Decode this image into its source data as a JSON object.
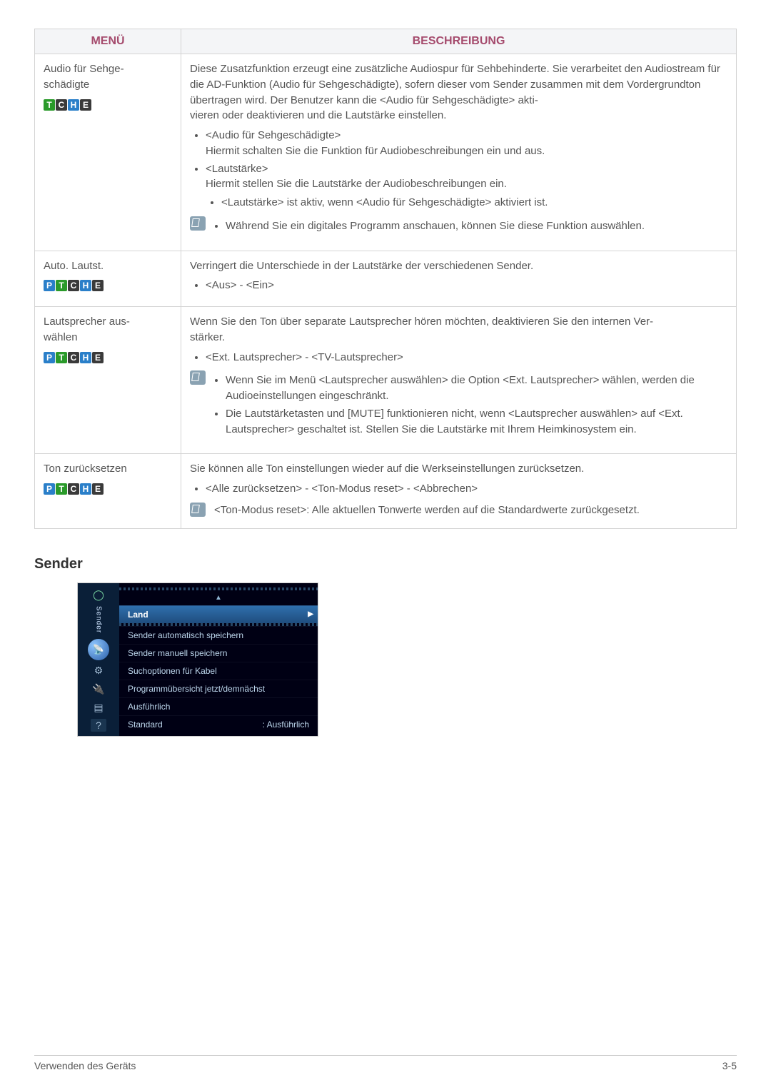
{
  "table": {
    "headers": {
      "menu": "MENÜ",
      "desc": "BESCHREIBUNG"
    },
    "rows": [
      {
        "left": {
          "title": "Audio für Sehge-\nschädigte",
          "badges": [
            "T",
            "C",
            "H",
            "E"
          ]
        },
        "para": "Diese Zusatzfunktion erzeugt eine zusätzliche Audiospur für Sehbehinderte. Sie verarbeitet den Audiostream für die AD-Funktion (Audio für Sehgeschädigte), sofern dieser vom Sender zusammen mit dem Vordergrundton übertragen wird. Der Benutzer kann die <Audio für Sehgeschädigte> akti-\nvieren oder deaktivieren und die Lautstärke einstellen.",
        "bullets": [
          {
            "head": "<Audio für Sehgeschädigte>",
            "body": "Hiermit schalten Sie die Funktion für Audiobeschreibungen ein und aus."
          },
          {
            "head": "<Lautstärke>",
            "body": "Hiermit stellen Sie die Lautstärke der Audiobeschreibungen ein.",
            "sub": [
              "<Lautstärke> ist aktiv, wenn <Audio für Sehgeschädigte> aktiviert ist."
            ]
          }
        ],
        "note_bullets": [
          "Während Sie ein digitales Programm anschauen, können Sie diese Funktion auswählen."
        ]
      },
      {
        "left": {
          "title": "Auto. Lautst.",
          "badges": [
            "P",
            "T",
            "C",
            "H",
            "E"
          ]
        },
        "para": "Verringert die Unterschiede in der Lautstärke der verschiedenen Sender.",
        "bullets": [
          {
            "head": "<Aus> - <Ein>"
          }
        ]
      },
      {
        "left": {
          "title": "Lautsprecher aus-\nwählen",
          "badges": [
            "P",
            "T",
            "C",
            "H",
            "E"
          ]
        },
        "para": "Wenn Sie den Ton über separate Lautsprecher hören möchten, deaktivieren Sie den internen Ver-\nstärker.",
        "bullets": [
          {
            "head": "<Ext. Lautsprecher> - <TV-Lautsprecher>"
          }
        ],
        "note_bullets": [
          "Wenn Sie im Menü <Lautsprecher auswählen> die Option <Ext. Lautsprecher> wählen, werden die Audioeinstellungen eingeschränkt.",
          "Die Lautstärketasten und [MUTE] funktionieren nicht, wenn <Lautsprecher auswählen> auf <Ext. Lautsprecher> geschaltet ist. Stellen Sie die Lautstärke mit Ihrem Heimkinosystem ein."
        ]
      },
      {
        "left": {
          "title": "Ton zurücksetzen",
          "badges": [
            "P",
            "T",
            "C",
            "H",
            "E"
          ]
        },
        "para": "Sie können alle Ton einstellungen wieder auf die Werkseinstellungen zurücksetzen.",
        "bullets": [
          {
            "head": "<Alle zurücksetzen> - <Ton-Modus reset> - <Abbrechen>"
          }
        ],
        "note_text": "<Ton-Modus reset>: Alle aktuellen Tonwerte werden auf die Standardwerte zurückgesetzt."
      }
    ]
  },
  "section2": {
    "heading": "Sender"
  },
  "osd": {
    "side_label": "Sender",
    "head_triangle": "▲",
    "items": [
      {
        "label": "Land",
        "selected": true
      },
      {
        "label": "Sender automatisch speichern"
      },
      {
        "label": "Sender manuell speichern"
      },
      {
        "label": "Suchoptionen für Kabel"
      },
      {
        "label": "Programmübersicht jetzt/demnächst"
      },
      {
        "label": "Ausführlich"
      },
      {
        "label": "Standard",
        "value": ": Ausführlich"
      }
    ]
  },
  "footer": {
    "left": "Verwenden des Geräts",
    "right": "3-5"
  }
}
